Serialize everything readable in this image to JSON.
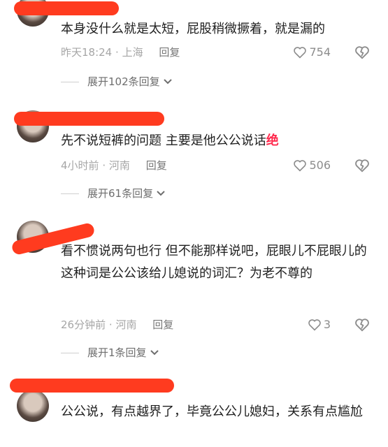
{
  "comments": [
    {
      "text": "本身没什么就是太短，屁股稍微撅着，就是漏的",
      "time": "昨天18:24",
      "location": "上海",
      "reply_label": "回复",
      "likes": "754",
      "expand_label": "展开102条回复"
    },
    {
      "text": "先不说短裤的问题 主要是他公公说话",
      "emphasis": "绝",
      "time": "4小时前",
      "location": "河南",
      "reply_label": "回复",
      "likes": "506",
      "expand_label": "展开61条回复"
    },
    {
      "text": "看不惯说两句也行 但不能那样说吧，屁眼儿不屁眼儿的这种词是公公该给儿媳说的词汇？为老不尊的",
      "time": "26分钟前",
      "location": "河南",
      "reply_label": "回复",
      "likes": "3",
      "expand_label": "展开1条回复"
    },
    {
      "text": "公公说，有点越界了，毕竟公公儿媳妇，关系有点尴尬"
    }
  ],
  "separator": "·",
  "icons": {
    "like": "heart-outline-icon",
    "dislike": "broken-heart-icon",
    "expand": "chevron-down-icon"
  },
  "colors": {
    "redaction": "#ff3b1f",
    "emphasis": "#ff2a4d"
  }
}
